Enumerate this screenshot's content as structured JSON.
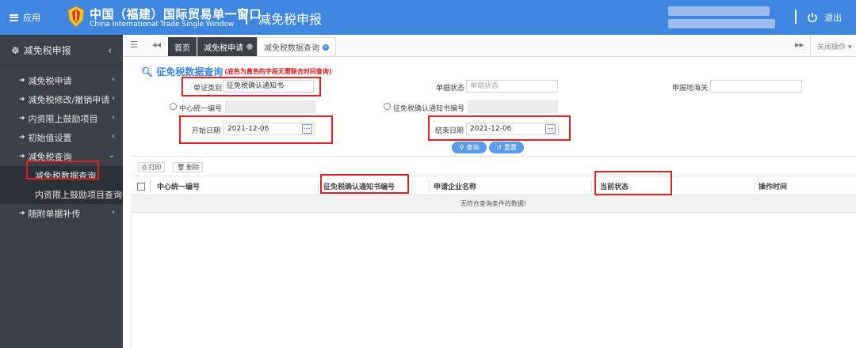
{
  "header": {
    "menu_label": "应用",
    "brand_cn": "中国（福建）国际贸易单一窗口",
    "brand_en": "China International Trade Single Window",
    "module_title": "减免税申报",
    "logout_label": "退出"
  },
  "sidebar": {
    "title": "减免税申报",
    "items": [
      {
        "label": "减免税申请"
      },
      {
        "label": "减免税修改/撤销申请"
      },
      {
        "label": "内资限上鼓励项目"
      },
      {
        "label": "初始值设置"
      },
      {
        "label": "减免税查询"
      }
    ],
    "sub_items": [
      {
        "label": "减免税数据查询"
      },
      {
        "label": "内资限上鼓励项目查询"
      }
    ],
    "last_item": {
      "label": "随附单据补传"
    }
  },
  "tabs": {
    "home": "首页",
    "items": [
      {
        "label": "减免税申请"
      },
      {
        "label": "减免税数据查询"
      }
    ],
    "close_ops": "关闭操作"
  },
  "form": {
    "title": "征免税数据查询",
    "note": "(底色为黄色的字段无需联合时间查询)",
    "doc_type_label": "单证类别",
    "doc_type_value": "征免税确认通知书",
    "doc_status_label": "单据状态",
    "doc_status_placeholder": "单据状态",
    "customs_label": "申报地海关",
    "center_no_label": "中心统一编号",
    "notice_no_label": "征免税确认通知书编号",
    "start_date_label": "开始日期",
    "start_date_value": "2021-12-06",
    "end_date_label": "结束日期",
    "end_date_value": "2021-12-06",
    "query_button": "查询",
    "reset_button": "重置"
  },
  "toolbar": {
    "print": "打印",
    "delete": "删除"
  },
  "table": {
    "columns": [
      "中心统一编号",
      "征免税确认通知书编号",
      "申请企业名称",
      "当前状态",
      "操作时间"
    ],
    "empty_text": "无符合查询条件的数据!"
  },
  "colors": {
    "header_blue": "#3f86e0",
    "sidebar_dark": "#3a3f48",
    "highlight_red": "#e02020"
  }
}
